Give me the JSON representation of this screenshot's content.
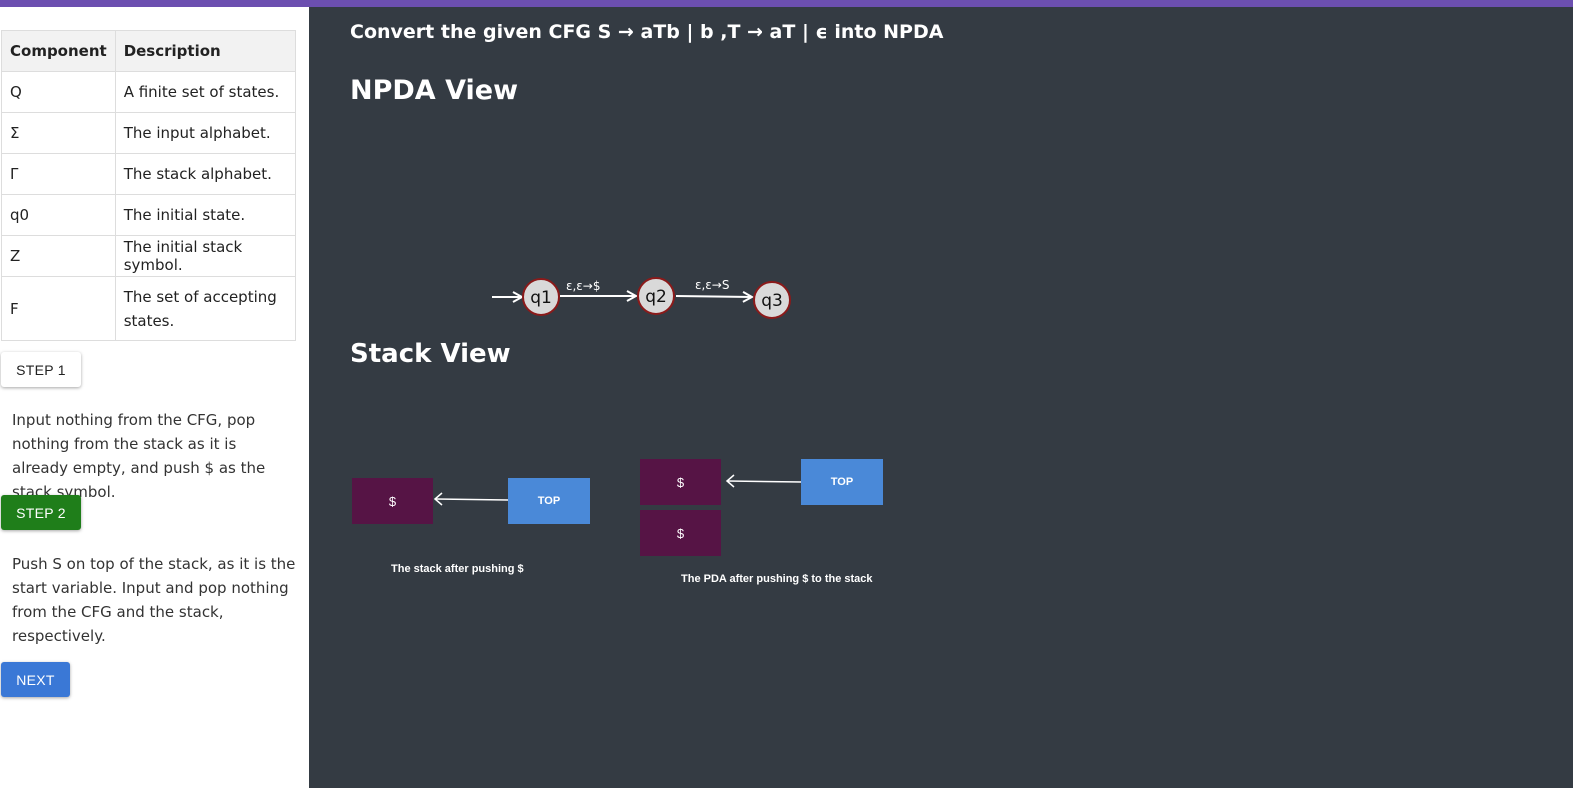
{
  "colors": {
    "top_bar": "#6c4fb0",
    "main_bg": "#343b43",
    "state_fill": "#d9d9d9",
    "state_border": "#8b1a1a",
    "stack_cell": "#561445",
    "stack_top": "#4a89d8",
    "step2_button": "#1f7e1a",
    "next_button": "#3a78d6"
  },
  "table": {
    "headers": [
      "Component",
      "Description"
    ],
    "rows": [
      [
        "Q",
        "A finite set of states."
      ],
      [
        "Σ",
        "The input alphabet."
      ],
      [
        "Γ",
        "The stack alphabet."
      ],
      [
        "q0",
        "The initial state."
      ],
      [
        "Z",
        "The initial stack symbol."
      ],
      [
        "F",
        "The set of accepting states."
      ]
    ]
  },
  "steps": {
    "step1_label": "STEP 1",
    "step1_text": "Input nothing from the CFG, pop nothing from the stack as it is already empty, and push $ as the stack symbol.",
    "step2_label": "STEP 2",
    "step2_text": "Push S on top of the stack, as it is the start variable. Input and pop nothing from the CFG and the stack, respectively.",
    "next_label": "NEXT"
  },
  "main": {
    "title": "Convert the given CFG S → aTb | b ,T → aT | ϵ into NPDA",
    "npda_heading": "NPDA View",
    "stack_heading": "Stack View"
  },
  "npda": {
    "states": [
      "q1",
      "q2",
      "q3"
    ],
    "transitions": [
      {
        "from": "q1",
        "to": "q2",
        "label": "ε,ε→$"
      },
      {
        "from": "q2",
        "to": "q3",
        "label": "ε,ε→S"
      }
    ]
  },
  "stack_view": {
    "stack1": {
      "cells": [
        "$"
      ],
      "top_label": "TOP",
      "caption": "The stack after pushing $"
    },
    "stack2": {
      "cells": [
        "$",
        "$"
      ],
      "top_label": "TOP",
      "caption": "The PDA after pushing $ to the stack"
    }
  }
}
